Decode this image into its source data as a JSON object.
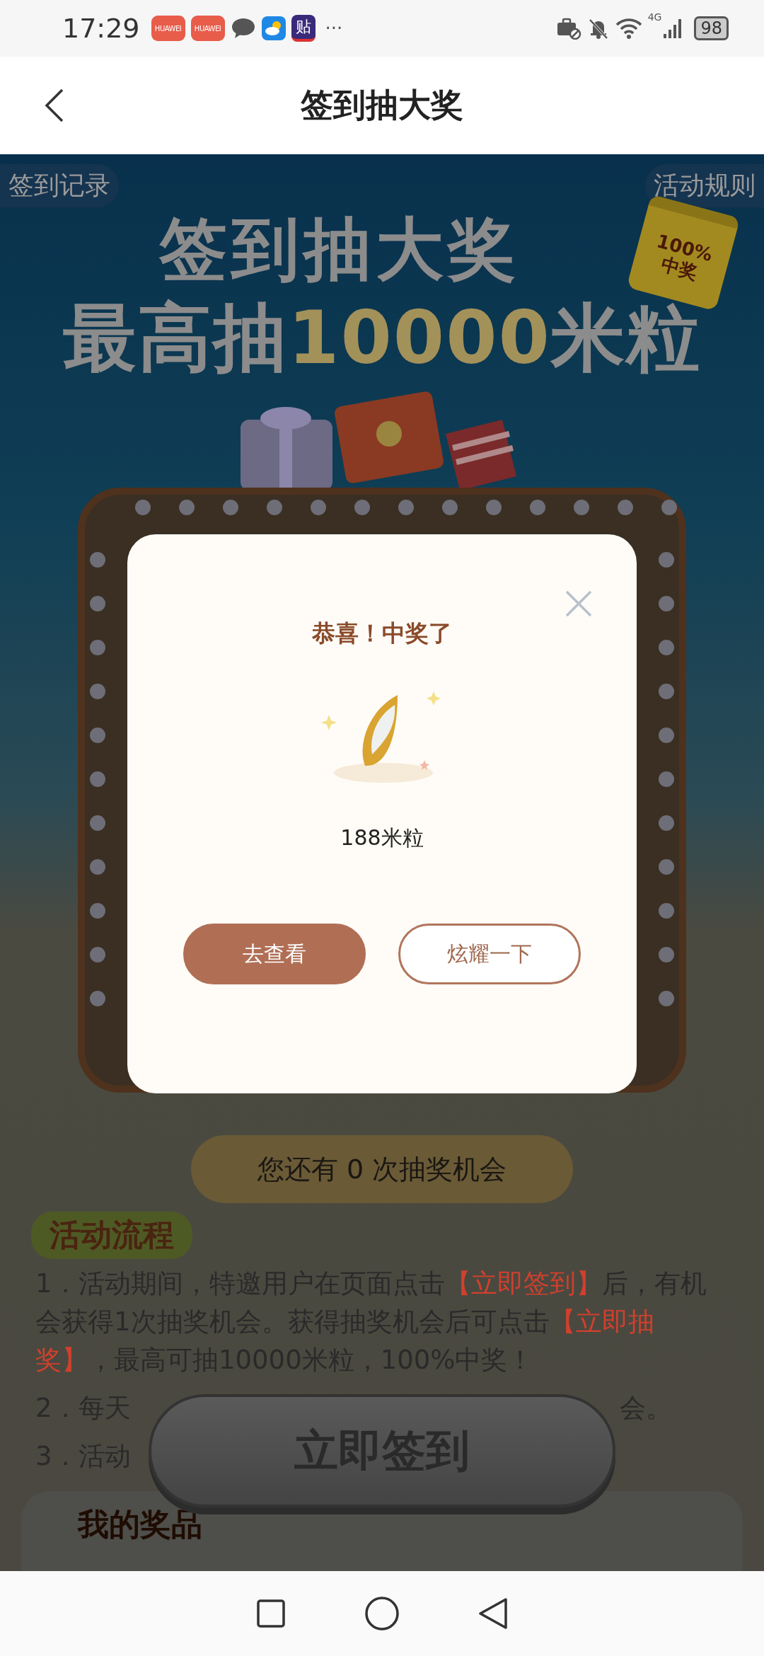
{
  "status_bar": {
    "time": "17:29",
    "app_badges": [
      "HUAWEI",
      "HUAWEI"
    ],
    "sticker_badge": "贴",
    "more": "···",
    "network": "4G",
    "battery": "98"
  },
  "header": {
    "title": "签到抽大奖"
  },
  "banner": {
    "left_link": "签到记录",
    "right_link": "活动规则",
    "headline": "签到抽大奖",
    "subline": [
      {
        "text": "最高抽",
        "highlight": false
      },
      {
        "text": "10000",
        "highlight": true
      },
      {
        "text": "米粒",
        "highlight": false
      }
    ],
    "badge": [
      "100%",
      "中奖"
    ]
  },
  "dialog": {
    "title": "恭喜！中奖了",
    "prize": "188米粒",
    "buttons": [
      {
        "label": "去查看",
        "kind": "primary"
      },
      {
        "label": "炫耀一下",
        "kind": "outline"
      }
    ]
  },
  "chances": "您还有 0 次抽奖机会",
  "process": {
    "heading": "活动流程",
    "steps": [
      {
        "segments": [
          {
            "text": "1．活动期间，特邀用户在页面点击",
            "highlight": false
          },
          {
            "text": "【立即签到】",
            "highlight": true
          },
          {
            "text": "后，有机会获得1次抽奖机会。获得抽奖机会后可点击",
            "highlight": false
          },
          {
            "text": "【立即抽奖】",
            "highlight": true
          },
          {
            "text": "，最高可抽10000米粒，100%中奖！",
            "highlight": false
          }
        ]
      },
      {
        "segments": [
          {
            "text": "2．每天",
            "highlight": false
          }
        ],
        "tail": "会。"
      },
      {
        "segments": [
          {
            "text": "3．活动",
            "highlight": false
          }
        ]
      }
    ]
  },
  "sign_in_button": "立即签到",
  "prizes": {
    "heading": "我的奖品"
  }
}
